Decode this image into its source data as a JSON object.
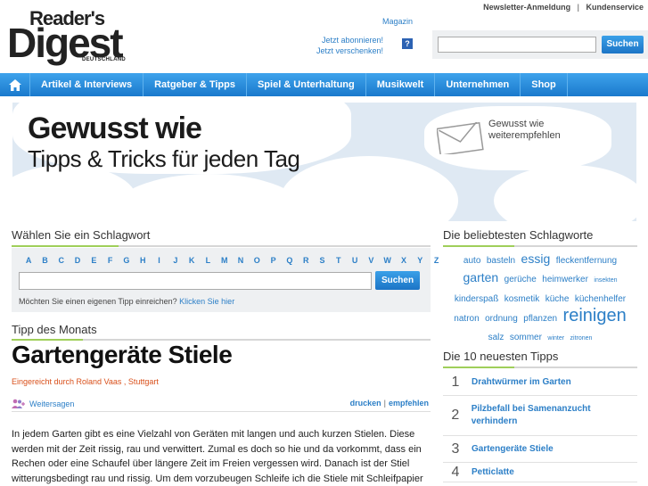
{
  "top_links": {
    "newsletter": "Newsletter-Anmeldung",
    "separator": "|",
    "service": "Kundenservice"
  },
  "logo": {
    "line1": "Reader's",
    "line2": "Digest",
    "line3": "DEUTSCHLAND"
  },
  "magazin": {
    "label": "Magazin",
    "subscribe": "Jetzt abonnieren!",
    "gift": "Jetzt verschenken!",
    "help": "?"
  },
  "search": {
    "placeholder": "",
    "button": "Suchen"
  },
  "nav": {
    "items": [
      "Artikel & Interviews",
      "Ratgeber & Tipps",
      "Spiel & Unterhaltung",
      "Musikwelt",
      "Unternehmen",
      "Shop"
    ]
  },
  "banner": {
    "title": "Gewusst wie",
    "subtitle": "Tipps & Tricks für jeden Tag",
    "share_line1": "Gewusst wie",
    "share_line2": "weiterempfehlen"
  },
  "keyword": {
    "heading": "Wählen Sie ein Schlagwort",
    "letters": [
      "A",
      "B",
      "C",
      "D",
      "E",
      "F",
      "G",
      "H",
      "I",
      "J",
      "K",
      "L",
      "M",
      "N",
      "O",
      "P",
      "Q",
      "R",
      "S",
      "T",
      "U",
      "V",
      "W",
      "X",
      "Y",
      "Z"
    ],
    "button": "Suchen",
    "own_tip_text": "Möchten Sie einen eigenen Tipp einreichen?",
    "own_tip_link": "Klicken Sie hier"
  },
  "tip_of_month": {
    "heading": "Tipp des Monats",
    "title": "Gartengeräte Stiele",
    "byline": "Eingereicht durch Roland Vaas , Stuttgart",
    "share": "Weitersagen",
    "print": "drucken",
    "separator": "|",
    "recommend": "empfehlen",
    "body": "In jedem Garten gibt es eine Vielzahl von Geräten mit langen und auch kurzen Stielen. Diese werden mit der Zeit rissig, rau und verwittert. Zumal es doch so hie und da vorkommt, dass ein Rechen oder eine Schaufel über längere Zeit im Freien vergessen wird. Danach ist der Stiel witterungsbedingt rau und rissig. Um dem vorzubeugen Schleife ich die Stiele mit Schleifpapier ab, bis die..."
  },
  "popular": {
    "heading": "Die beliebtesten Schlagworte",
    "tags": [
      {
        "text": "auto",
        "size": 10
      },
      {
        "text": "basteln",
        "size": 10
      },
      {
        "text": "essig",
        "size": 14
      },
      {
        "text": "fleckentfernung",
        "size": 10
      },
      {
        "text": "garten",
        "size": 14
      },
      {
        "text": "gerüche",
        "size": 10
      },
      {
        "text": "heimwerker",
        "size": 10
      },
      {
        "text": "insekten",
        "size": 7
      },
      {
        "text": "kinderspaß",
        "size": 10
      },
      {
        "text": "kosmetik",
        "size": 10
      },
      {
        "text": "küche",
        "size": 10
      },
      {
        "text": "küchenhelfer",
        "size": 10
      },
      {
        "text": "natron",
        "size": 10
      },
      {
        "text": "ordnung",
        "size": 10
      },
      {
        "text": "pflanzen",
        "size": 10
      },
      {
        "text": "reinigen",
        "size": 20
      },
      {
        "text": "salz",
        "size": 10
      },
      {
        "text": "sommer",
        "size": 10
      },
      {
        "text": "winter",
        "size": 7
      },
      {
        "text": "zitronen",
        "size": 7
      }
    ]
  },
  "newest": {
    "heading": "Die 10 neuesten Tipps",
    "items": [
      {
        "num": "1",
        "label": "Drahtwürmer im Garten"
      },
      {
        "num": "2",
        "label": "Pilzbefall bei Samenanzucht verhindern"
      },
      {
        "num": "3",
        "label": "Gartengeräte Stiele"
      },
      {
        "num": "4",
        "label": "Petticlatte"
      }
    ]
  },
  "colors": {
    "accent": "#2c7fc7",
    "nav": "#1a79cc",
    "green": "#9fcf5a",
    "byline": "#d9501b"
  }
}
